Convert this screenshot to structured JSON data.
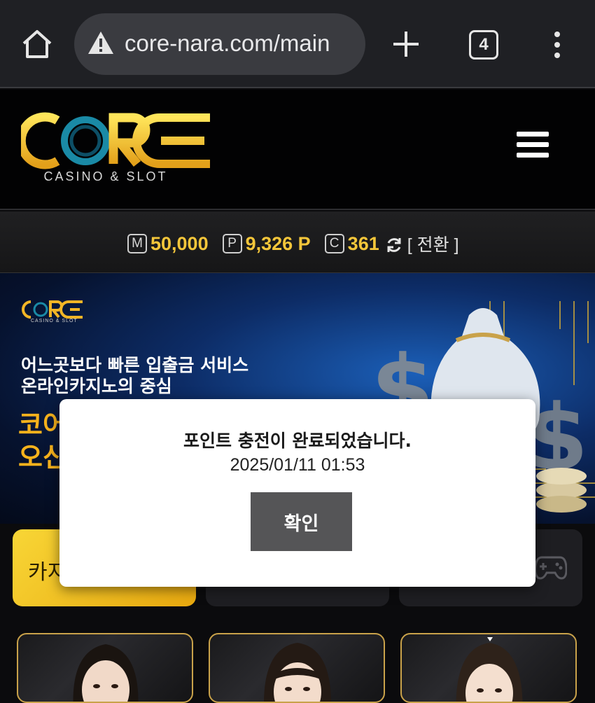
{
  "browser": {
    "url": "core-nara.com/main",
    "tab_count": "4"
  },
  "site": {
    "logo_text": "CORE",
    "logo_sub": "CASINO & SLOT"
  },
  "balance": {
    "money_badge": "M",
    "money": "50,000",
    "point_badge": "P",
    "point": "9,326 P",
    "coin_badge": "C",
    "coin": "361",
    "switch_label": "[ 전환 ]"
  },
  "banner": {
    "line1": "어느곳보다 빠른 입출금 서비스",
    "line2": "온라인카지노의 중심",
    "gold1": "코어",
    "gold2": "오신"
  },
  "categories": {
    "casino_label": "카지"
  },
  "modal": {
    "message": "포인트 충전이 완료되었습니다.",
    "timestamp": "2025/01/11 01:53",
    "confirm_label": "확인"
  },
  "colors": {
    "accent_gold": "#f4c63a",
    "modal_button": "#555557",
    "header_bg": "#020203"
  }
}
